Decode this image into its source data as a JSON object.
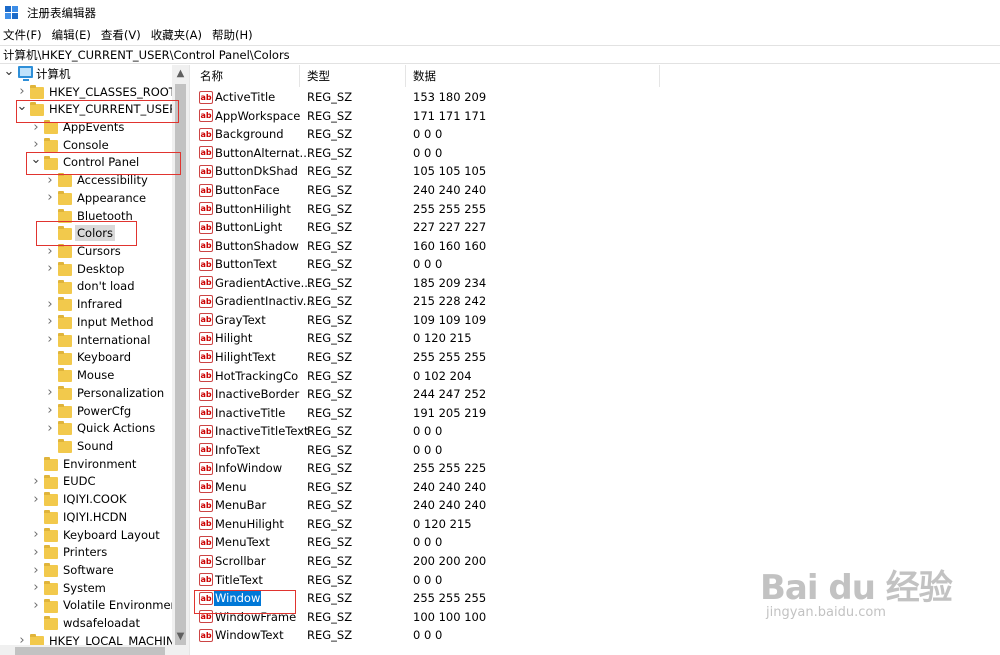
{
  "window": {
    "title": "注册表编辑器"
  },
  "menu": [
    "文件(F)",
    "编辑(E)",
    "查看(V)",
    "收藏夹(A)",
    "帮助(H)"
  ],
  "address": "计算机\\HKEY_CURRENT_USER\\Control Panel\\Colors",
  "columns": {
    "name": "名称",
    "type": "类型",
    "data": "数据"
  },
  "tree": [
    {
      "label": "计算机",
      "level": 0,
      "state": "expanded",
      "icon": "computer-icon"
    },
    {
      "label": "HKEY_CLASSES_ROOT",
      "level": 1,
      "state": "collapsed",
      "icon": "folder-icon"
    },
    {
      "label": "HKEY_CURRENT_USER",
      "level": 1,
      "state": "expanded",
      "icon": "folder-icon"
    },
    {
      "label": "AppEvents",
      "level": 2,
      "state": "collapsed",
      "icon": "folder-icon"
    },
    {
      "label": "Console",
      "level": 2,
      "state": "collapsed",
      "icon": "folder-icon"
    },
    {
      "label": "Control Panel",
      "level": 2,
      "state": "expanded",
      "icon": "folder-icon"
    },
    {
      "label": "Accessibility",
      "level": 3,
      "state": "collapsed",
      "icon": "folder-icon"
    },
    {
      "label": "Appearance",
      "level": 3,
      "state": "collapsed",
      "icon": "folder-icon"
    },
    {
      "label": "Bluetooth",
      "level": 3,
      "state": "none",
      "icon": "folder-icon"
    },
    {
      "label": "Colors",
      "level": 3,
      "state": "none",
      "icon": "folder-icon",
      "selected": true
    },
    {
      "label": "Cursors",
      "level": 3,
      "state": "collapsed",
      "icon": "folder-icon"
    },
    {
      "label": "Desktop",
      "level": 3,
      "state": "collapsed",
      "icon": "folder-icon"
    },
    {
      "label": "don't load",
      "level": 3,
      "state": "none",
      "icon": "folder-icon"
    },
    {
      "label": "Infrared",
      "level": 3,
      "state": "collapsed",
      "icon": "folder-icon"
    },
    {
      "label": "Input Method",
      "level": 3,
      "state": "collapsed",
      "icon": "folder-icon"
    },
    {
      "label": "International",
      "level": 3,
      "state": "collapsed",
      "icon": "folder-icon"
    },
    {
      "label": "Keyboard",
      "level": 3,
      "state": "none",
      "icon": "folder-icon"
    },
    {
      "label": "Mouse",
      "level": 3,
      "state": "none",
      "icon": "folder-icon"
    },
    {
      "label": "Personalization",
      "level": 3,
      "state": "collapsed",
      "icon": "folder-icon"
    },
    {
      "label": "PowerCfg",
      "level": 3,
      "state": "collapsed",
      "icon": "folder-icon"
    },
    {
      "label": "Quick Actions",
      "level": 3,
      "state": "collapsed",
      "icon": "folder-icon"
    },
    {
      "label": "Sound",
      "level": 3,
      "state": "none",
      "icon": "folder-icon"
    },
    {
      "label": "Environment",
      "level": 2,
      "state": "none",
      "icon": "folder-icon"
    },
    {
      "label": "EUDC",
      "level": 2,
      "state": "collapsed",
      "icon": "folder-icon"
    },
    {
      "label": "IQIYI.COOK",
      "level": 2,
      "state": "collapsed",
      "icon": "folder-icon"
    },
    {
      "label": "IQIYI.HCDN",
      "level": 2,
      "state": "none",
      "icon": "folder-icon"
    },
    {
      "label": "Keyboard Layout",
      "level": 2,
      "state": "collapsed",
      "icon": "folder-icon"
    },
    {
      "label": "Printers",
      "level": 2,
      "state": "collapsed",
      "icon": "folder-icon"
    },
    {
      "label": "Software",
      "level": 2,
      "state": "collapsed",
      "icon": "folder-icon"
    },
    {
      "label": "System",
      "level": 2,
      "state": "collapsed",
      "icon": "folder-icon"
    },
    {
      "label": "Volatile Environment",
      "level": 2,
      "state": "collapsed",
      "icon": "folder-icon"
    },
    {
      "label": "wdsafeloadat",
      "level": 2,
      "state": "none",
      "icon": "folder-icon"
    },
    {
      "label": "HKEY_LOCAL_MACHINE",
      "level": 1,
      "state": "collapsed",
      "icon": "folder-icon"
    }
  ],
  "values": [
    {
      "name": "ActiveTitle",
      "type": "REG_SZ",
      "data": "153 180 209"
    },
    {
      "name": "AppWorkspace",
      "type": "REG_SZ",
      "data": "171 171 171"
    },
    {
      "name": "Background",
      "type": "REG_SZ",
      "data": "0 0 0"
    },
    {
      "name": "ButtonAlternat...",
      "type": "REG_SZ",
      "data": "0 0 0"
    },
    {
      "name": "ButtonDkShad",
      "type": "REG_SZ",
      "data": "105 105 105"
    },
    {
      "name": "ButtonFace",
      "type": "REG_SZ",
      "data": "240 240 240"
    },
    {
      "name": "ButtonHilight",
      "type": "REG_SZ",
      "data": "255 255 255"
    },
    {
      "name": "ButtonLight",
      "type": "REG_SZ",
      "data": "227 227 227"
    },
    {
      "name": "ButtonShadow",
      "type": "REG_SZ",
      "data": "160 160 160"
    },
    {
      "name": "ButtonText",
      "type": "REG_SZ",
      "data": "0 0 0"
    },
    {
      "name": "GradientActive...",
      "type": "REG_SZ",
      "data": "185 209 234"
    },
    {
      "name": "GradientInactiv...",
      "type": "REG_SZ",
      "data": "215 228 242"
    },
    {
      "name": "GrayText",
      "type": "REG_SZ",
      "data": "109 109 109"
    },
    {
      "name": "Hilight",
      "type": "REG_SZ",
      "data": "0 120 215"
    },
    {
      "name": "HilightText",
      "type": "REG_SZ",
      "data": "255 255 255"
    },
    {
      "name": "HotTrackingCo",
      "type": "REG_SZ",
      "data": "0 102 204"
    },
    {
      "name": "InactiveBorder",
      "type": "REG_SZ",
      "data": "244 247 252"
    },
    {
      "name": "InactiveTitle",
      "type": "REG_SZ",
      "data": "191 205 219"
    },
    {
      "name": "InactiveTitleText",
      "type": "REG_SZ",
      "data": "0 0 0"
    },
    {
      "name": "InfoText",
      "type": "REG_SZ",
      "data": "0 0 0"
    },
    {
      "name": "InfoWindow",
      "type": "REG_SZ",
      "data": "255 255 225"
    },
    {
      "name": "Menu",
      "type": "REG_SZ",
      "data": "240 240 240"
    },
    {
      "name": "MenuBar",
      "type": "REG_SZ",
      "data": "240 240 240"
    },
    {
      "name": "MenuHilight",
      "type": "REG_SZ",
      "data": "0 120 215"
    },
    {
      "name": "MenuText",
      "type": "REG_SZ",
      "data": "0 0 0"
    },
    {
      "name": "Scrollbar",
      "type": "REG_SZ",
      "data": "200 200 200"
    },
    {
      "name": "TitleText",
      "type": "REG_SZ",
      "data": "0 0 0"
    },
    {
      "name": "Window",
      "type": "REG_SZ",
      "data": "255 255 255",
      "selected": true
    },
    {
      "name": "WindowFrame",
      "type": "REG_SZ",
      "data": "100 100 100"
    },
    {
      "name": "WindowText",
      "type": "REG_SZ",
      "data": "0 0 0"
    }
  ],
  "watermark": {
    "big": "Bai du 经验",
    "small": "jingyan.baidu.com"
  },
  "colors": {
    "selection": "#0078d7",
    "annotation_box": "#e0342f",
    "folder": "#f2c94c"
  }
}
